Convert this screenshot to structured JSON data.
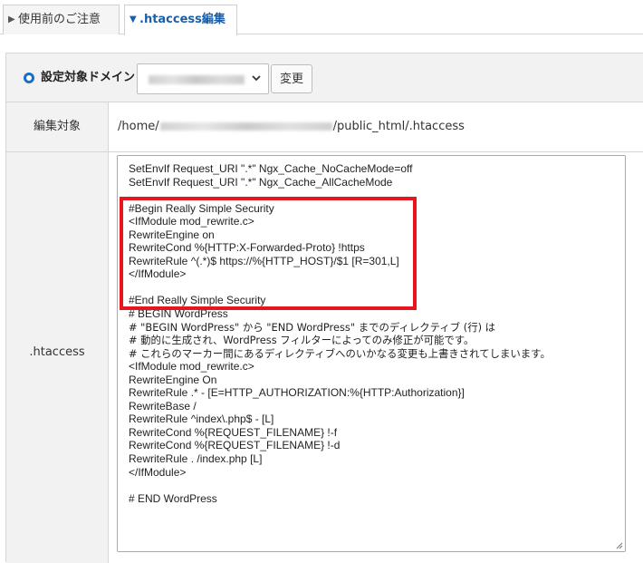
{
  "tabs": [
    {
      "label": "使用前のご注意",
      "active": false
    },
    {
      "label": ".htaccess編集",
      "active": true
    }
  ],
  "domain": {
    "label": "設定対象ドメイン",
    "select_value": "",
    "change_label": "変更"
  },
  "target": {
    "label": "編集対象",
    "path_prefix": "/home/",
    "path_suffix": "/public_html/.htaccess"
  },
  "htaccess": {
    "label": ".htaccess",
    "lines": [
      "SetEnvIf Request_URI \".*\" Ngx_Cache_NoCacheMode=off",
      "SetEnvIf Request_URI \".*\" Ngx_Cache_AllCacheMode",
      "",
      "#Begin Really Simple Security",
      "<IfModule mod_rewrite.c>",
      "RewriteEngine on",
      "RewriteCond %{HTTP:X-Forwarded-Proto} !https",
      "RewriteRule ^(.*)$ https://%{HTTP_HOST}/$1 [R=301,L]",
      "</IfModule>",
      "",
      "#End Really Simple Security",
      "# BEGIN WordPress",
      "# \"BEGIN WordPress\" から \"END WordPress\" までのディレクティブ (行) は",
      "# 動的に生成され、WordPress フィルターによってのみ修正が可能です。",
      "# これらのマーカー間にあるディレクティブへのいかなる変更も上書きされてしまいます。",
      "<IfModule mod_rewrite.c>",
      "RewriteEngine On",
      "RewriteRule .* - [E=HTTP_AUTHORIZATION:%{HTTP:Authorization}]",
      "RewriteBase /",
      "RewriteRule ^index\\.php$ - [L]",
      "RewriteCond %{REQUEST_FILENAME} !-f",
      "RewriteCond %{REQUEST_FILENAME} !-d",
      "RewriteRule . /index.php [L]",
      "</IfModule>",
      "",
      "# END WordPress"
    ]
  },
  "colors": {
    "highlight": "#e8141e",
    "accent": "#1a6fc4"
  }
}
